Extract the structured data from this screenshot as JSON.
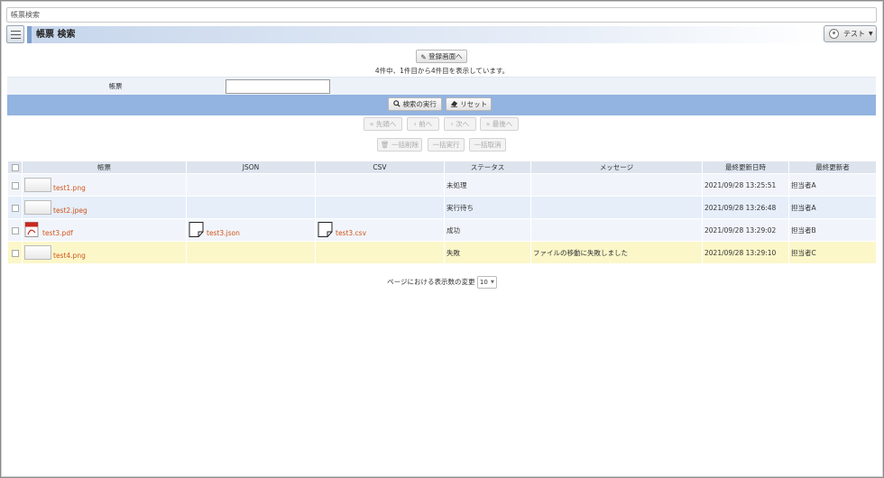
{
  "address_bar": {
    "text": "帳票検索"
  },
  "header": {
    "title": "帳票 検索",
    "user": "テスト"
  },
  "register_button": {
    "label": "登録画面へ"
  },
  "summary": "4件中、1件目から4件目を表示しています。",
  "search": {
    "label": "帳票",
    "value": "",
    "exec_label": "検索の実行",
    "reset_label": "リセット"
  },
  "pager": {
    "first": "先頭へ",
    "prev": "前へ",
    "next": "次へ",
    "last": "最後へ"
  },
  "bulk": {
    "delete": "一括削除",
    "execute": "一括実行",
    "cancel": "一括取消"
  },
  "table": {
    "columns": [
      "帳票",
      "JSON",
      "CSV",
      "ステータス",
      "メッセージ",
      "最終更新日時",
      "最終更新者"
    ],
    "rows": [
      {
        "file": "test1.png",
        "json": "",
        "csv": "",
        "status": "未処理",
        "message": "",
        "updated": "2021/09/28 13:25:51",
        "updater": "担当者A"
      },
      {
        "file": "test2.jpeg",
        "json": "",
        "csv": "",
        "status": "実行待ち",
        "message": "",
        "updated": "2021/09/28 13:26:48",
        "updater": "担当者A"
      },
      {
        "file": "test3.pdf",
        "json": "test3.json",
        "csv": "test3.csv",
        "status": "成功",
        "message": "",
        "updated": "2021/09/28 13:29:02",
        "updater": "担当者B"
      },
      {
        "file": "test4.png",
        "json": "",
        "csv": "",
        "status": "失敗",
        "message": "ファイルの移動に失敗しました",
        "updated": "2021/09/28 13:29:10",
        "updater": "担当者C"
      }
    ]
  },
  "page_size": {
    "label": "ページにおける表示数の変更",
    "value": "10"
  },
  "icons": {
    "register": "pencil-icon",
    "search": "magnifier-icon",
    "reset": "eraser-icon",
    "menu": "hamburger-icon",
    "user": "user-avatar-icon"
  },
  "colors": {
    "action_bar": "#93b3e0",
    "failed_row": "#fbf7c9",
    "link": "#d2541a"
  }
}
